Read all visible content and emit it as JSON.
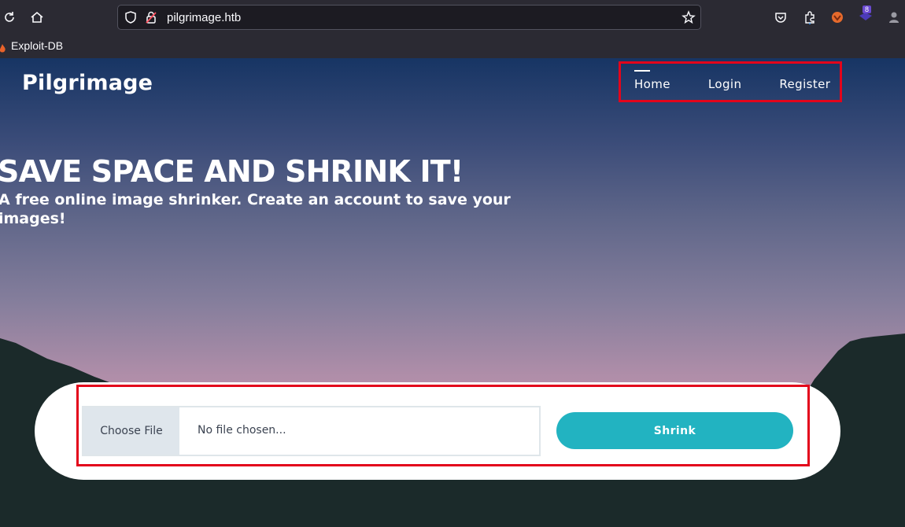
{
  "browser": {
    "url": "pilgrimage.htb",
    "bookmark_label": "Exploit-DB",
    "extension_badge": "8"
  },
  "site": {
    "brand": "Pilgrimage",
    "nav": [
      {
        "label": "Home",
        "active": true
      },
      {
        "label": "Login",
        "active": false
      },
      {
        "label": "Register",
        "active": false
      }
    ],
    "hero_title": "SAVE SPACE AND SHRINK IT!",
    "hero_subtitle": "A free online image shrinker. Create an account to save your images!"
  },
  "upload": {
    "choose_label": "Choose File",
    "file_status": "No file chosen...",
    "submit_label": "Shrink"
  },
  "colors": {
    "highlight": "#e3051b",
    "button": "#22b3c1",
    "sky_top": "#173564",
    "sky_bottom": "#c095ad",
    "mountains": "#1b2a2a"
  }
}
